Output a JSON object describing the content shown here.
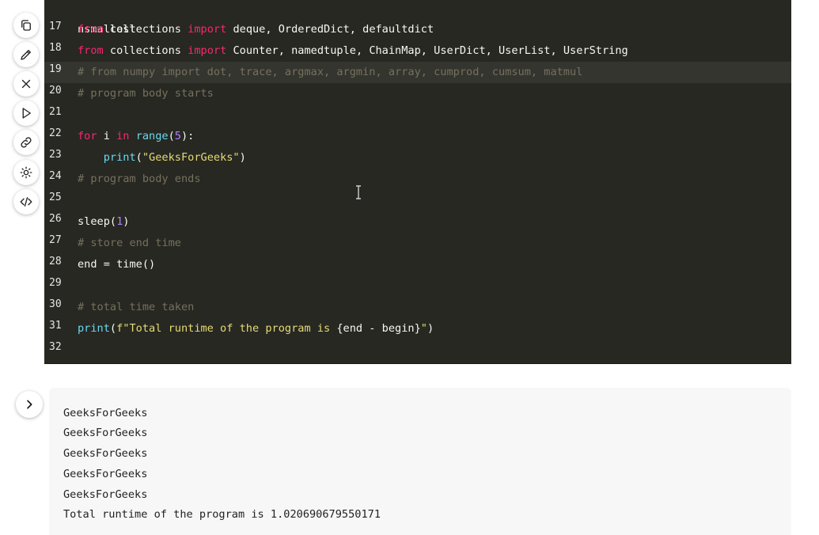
{
  "toolbar": {
    "icons": [
      "copy-icon",
      "edit-icon",
      "close-icon",
      "play-icon",
      "link-icon",
      "theme-icon",
      "embed-code-icon"
    ]
  },
  "editor": {
    "partial_line": "nsmallest",
    "lines": [
      {
        "n": "17",
        "tokens": [
          [
            "kw",
            "from"
          ],
          [
            "",
            " collections "
          ],
          [
            "kw",
            "import"
          ],
          [
            "",
            " deque, OrderedDict, defaultdict"
          ]
        ]
      },
      {
        "n": "18",
        "tokens": [
          [
            "kw",
            "from"
          ],
          [
            "",
            " collections "
          ],
          [
            "kw",
            "import"
          ],
          [
            "",
            " Counter, namedtuple, ChainMap, UserDict, UserList, UserString"
          ]
        ]
      },
      {
        "n": "19",
        "tokens": [
          [
            "cm",
            "# from numpy import dot, trace, argmax, argmin, array, cumprod, cumsum, matmul"
          ]
        ]
      },
      {
        "n": "20",
        "tokens": [
          [
            "cm",
            "# program body starts"
          ]
        ]
      },
      {
        "n": "21",
        "tokens": []
      },
      {
        "n": "22",
        "tokens": [
          [
            "kw",
            "for"
          ],
          [
            "",
            " i "
          ],
          [
            "kw",
            "in"
          ],
          [
            "",
            " "
          ],
          [
            "fn",
            "range"
          ],
          [
            "",
            "("
          ],
          [
            "num",
            "5"
          ],
          [
            "",
            "):"
          ]
        ]
      },
      {
        "n": "23",
        "tokens": [
          [
            "",
            "    "
          ],
          [
            "fn",
            "print"
          ],
          [
            "",
            "("
          ],
          [
            "str",
            "\"GeeksForGeeks\""
          ],
          [
            "",
            ")"
          ]
        ]
      },
      {
        "n": "24",
        "tokens": [
          [
            "cm",
            "# program body ends"
          ]
        ]
      },
      {
        "n": "25",
        "tokens": []
      },
      {
        "n": "26",
        "tokens": [
          [
            "",
            "sleep("
          ],
          [
            "num",
            "1"
          ],
          [
            "",
            ")"
          ]
        ]
      },
      {
        "n": "27",
        "tokens": [
          [
            "cm",
            "# store end time"
          ]
        ]
      },
      {
        "n": "28",
        "tokens": [
          [
            "",
            "end = time()"
          ]
        ]
      },
      {
        "n": "29",
        "tokens": []
      },
      {
        "n": "30",
        "tokens": [
          [
            "cm",
            "# total time taken"
          ]
        ]
      },
      {
        "n": "31",
        "tokens": [
          [
            "fn",
            "print"
          ],
          [
            "",
            "("
          ],
          [
            "str",
            "f\"Total runtime of the program is "
          ],
          [
            "",
            "{end - begin}"
          ],
          [
            "str",
            "\""
          ],
          [
            "",
            ")"
          ]
        ]
      },
      {
        "n": "32",
        "tokens": []
      }
    ]
  },
  "output": {
    "lines": [
      "GeeksForGeeks",
      "GeeksForGeeks",
      "GeeksForGeeks",
      "GeeksForGeeks",
      "GeeksForGeeks",
      "Total runtime of the program is 1.020690679550171"
    ]
  }
}
